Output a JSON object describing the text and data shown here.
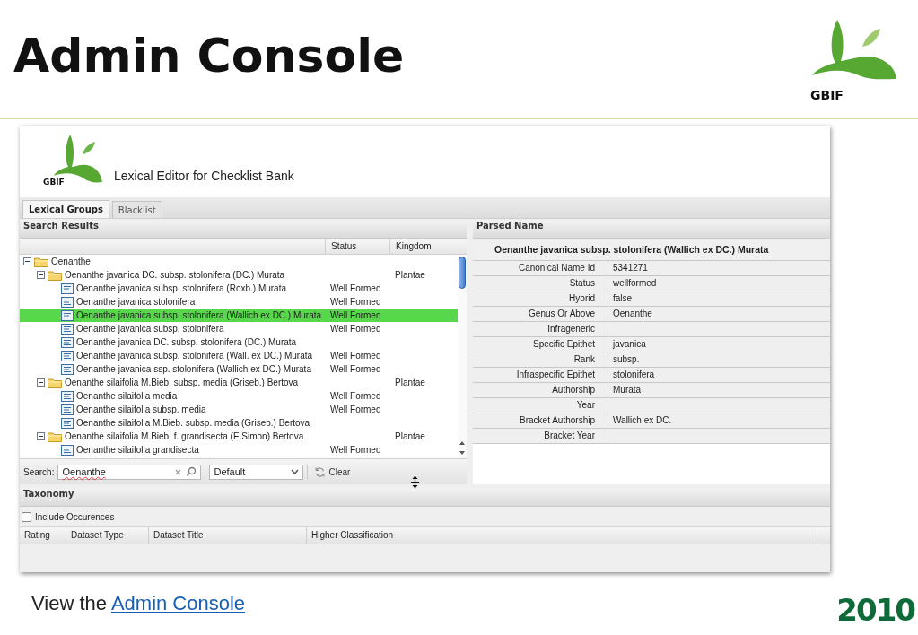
{
  "slide_title": "Admin Console",
  "brand": "GBIF",
  "app": {
    "logo_text": "GBIF",
    "title": "Lexical Editor for Checklist Bank",
    "tabs": [
      {
        "label": "Lexical Groups",
        "selected": true
      },
      {
        "label": "Blacklist",
        "selected": false
      }
    ],
    "search_results": {
      "title": "Search Results",
      "columns": [
        "Status",
        "Kingdom"
      ],
      "tree": [
        {
          "name": "Oenanthe",
          "kind": "group",
          "expanded": true,
          "selected": false,
          "children": [
            {
              "name": "Oenanthe javanica DC. subsp. stolonifera (DC.) Murata",
              "kind": "group",
              "expanded": true,
              "selected": false,
              "kingdom": "Plantae",
              "children": [
                {
                  "name": "Oenanthe javanica subsp. stolonifera (Roxb.) Murata",
                  "kind": "name",
                  "selected": false,
                  "status": "Well Formed"
                },
                {
                  "name": "Oenanthe javanica stolonifera",
                  "kind": "name",
                  "selected": false,
                  "status": "Well Formed"
                },
                {
                  "name": "Oenanthe javanica subsp. stolonifera (Wallich ex DC.) Murata",
                  "kind": "name",
                  "selected": true,
                  "status": "Well Formed"
                },
                {
                  "name": "Oenanthe javanica subsp. stolonifera",
                  "kind": "name",
                  "selected": false,
                  "status": "Well Formed"
                },
                {
                  "name": "Oenanthe javanica DC. subsp. stolonifera (DC.) Murata",
                  "kind": "name",
                  "selected": false
                },
                {
                  "name": "Oenanthe javanica subsp. stolonifera (Wall. ex DC.) Murata",
                  "kind": "name",
                  "selected": false,
                  "status": "Well Formed"
                },
                {
                  "name": "Oenanthe javanica ssp. stolonifera (Wallich ex DC.) Murata",
                  "kind": "name",
                  "selected": false,
                  "status": "Well Formed"
                }
              ]
            },
            {
              "name": "Oenanthe silaifolia M.Bieb. subsp. media (Griseb.) Bertova",
              "kind": "group",
              "expanded": true,
              "selected": false,
              "kingdom": "Plantae",
              "children": [
                {
                  "name": "Oenanthe silaifolia media",
                  "kind": "name",
                  "selected": false,
                  "status": "Well Formed"
                },
                {
                  "name": "Oenanthe silaifolia subsp. media",
                  "kind": "name",
                  "selected": false,
                  "status": "Well Formed"
                },
                {
                  "name": "Oenanthe silaifolia M.Bieb. subsp. media (Griseb.) Bertova",
                  "kind": "name",
                  "selected": false
                }
              ]
            },
            {
              "name": "Oenanthe silaifolia M.Bieb. f. grandisecta (E.Simon) Bertova",
              "kind": "group",
              "expanded": true,
              "selected": false,
              "kingdom": "Plantae",
              "children": [
                {
                  "name": "Oenanthe silaifolia grandisecta",
                  "kind": "name",
                  "selected": false,
                  "status": "Well Formed"
                }
              ]
            }
          ]
        }
      ]
    },
    "search": {
      "label": "Search:",
      "value": "Oenanthe",
      "mode": "Default",
      "clear": "Clear"
    },
    "parsed_name": {
      "title": "Parsed Name",
      "name": "Oenanthe javanica subsp. stolonifera (Wallich ex DC.) Murata",
      "fields": [
        {
          "label": "Canonical Name Id",
          "value": "5341271"
        },
        {
          "label": "Status",
          "value": "wellformed"
        },
        {
          "label": "Hybrid",
          "value": "false"
        },
        {
          "label": "Genus Or Above",
          "value": "Oenanthe"
        },
        {
          "label": "Infrageneric"
        },
        {
          "label": "Specific Epithet",
          "value": "javanica"
        },
        {
          "label": "Rank",
          "value": "subsp."
        },
        {
          "label": "Infraspecific Epithet",
          "value": "stolonifera"
        },
        {
          "label": "Authorship",
          "value": "Murata"
        },
        {
          "label": "Year"
        },
        {
          "label": "Bracket Authorship",
          "value": "Wallich ex DC."
        },
        {
          "label": "Bracket Year"
        }
      ]
    },
    "taxonomy": {
      "title": "Taxonomy",
      "include": {
        "label": "Include Occurences",
        "checked": false
      },
      "columns": [
        "Rating",
        "Dataset Type",
        "Dataset Title",
        "Higher Classification"
      ]
    }
  },
  "caption": {
    "text": "View the",
    "link": "Admin Console"
  },
  "year_logo": "2010"
}
